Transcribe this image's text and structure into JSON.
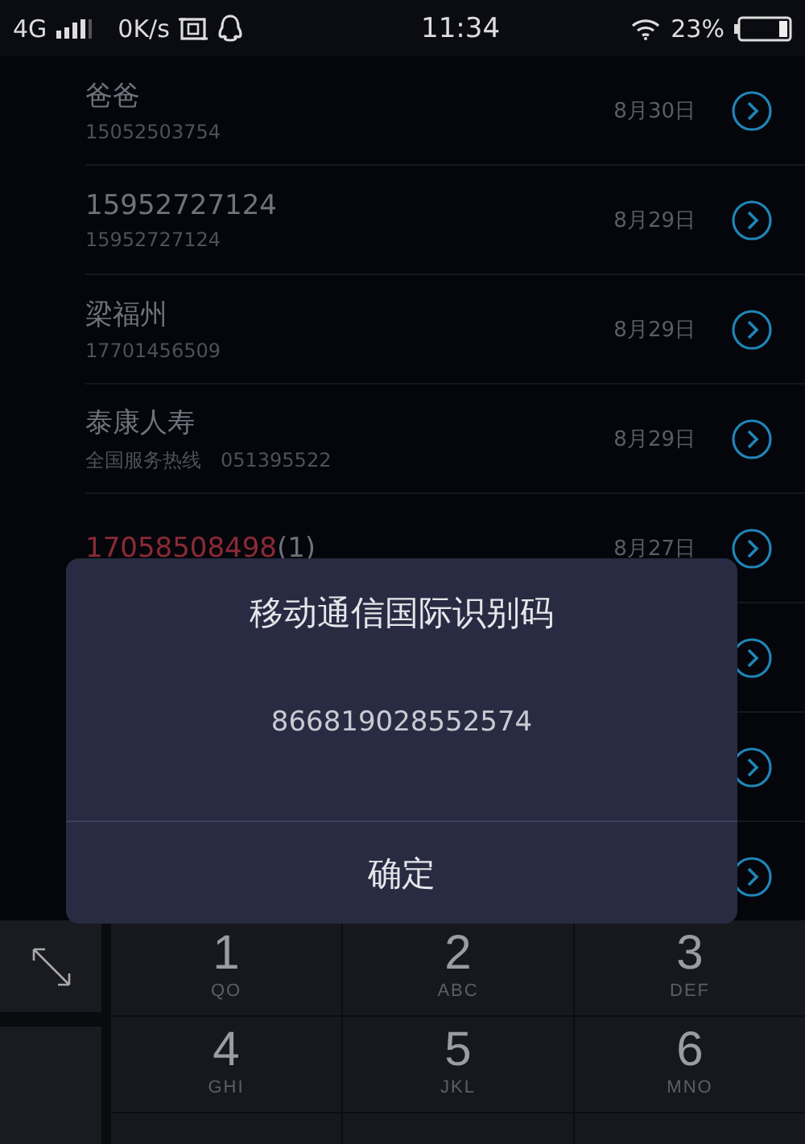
{
  "status_bar": {
    "network": "4G",
    "speed": "0K/s",
    "time": "11:34",
    "battery_percent": "23%"
  },
  "calls": [
    {
      "kind": "entry",
      "name": "爸爸",
      "subtitle": "15052503754",
      "date": "8月30日",
      "missed": false
    },
    {
      "kind": "entry",
      "name": "15952727124",
      "subtitle": "15952727124",
      "date": "8月29日",
      "missed": false
    },
    {
      "kind": "entry",
      "name": "梁福州",
      "subtitle": "17701456509",
      "date": "8月29日",
      "missed": false
    },
    {
      "kind": "entry",
      "name": "泰康人寿",
      "subtitle": "全国服务热线　051395522",
      "date": "8月29日",
      "missed": false
    },
    {
      "kind": "entry",
      "name": "17058508498",
      "count": "(1)",
      "date": "8月27日",
      "missed": true
    },
    {
      "kind": "covered"
    },
    {
      "kind": "covered"
    },
    {
      "kind": "covered"
    }
  ],
  "dialog": {
    "title": "移动通信国际识别码",
    "message": "866819028552574",
    "button": "确定"
  },
  "keypad": [
    {
      "digit": "1",
      "letters": "QO"
    },
    {
      "digit": "2",
      "letters": "ABC"
    },
    {
      "digit": "3",
      "letters": "DEF"
    },
    {
      "digit": "4",
      "letters": "GHI"
    },
    {
      "digit": "5",
      "letters": "JKL"
    },
    {
      "digit": "6",
      "letters": "MNO"
    },
    {
      "kind": "cut"
    },
    {
      "kind": "cut"
    },
    {
      "kind": "cut"
    }
  ]
}
